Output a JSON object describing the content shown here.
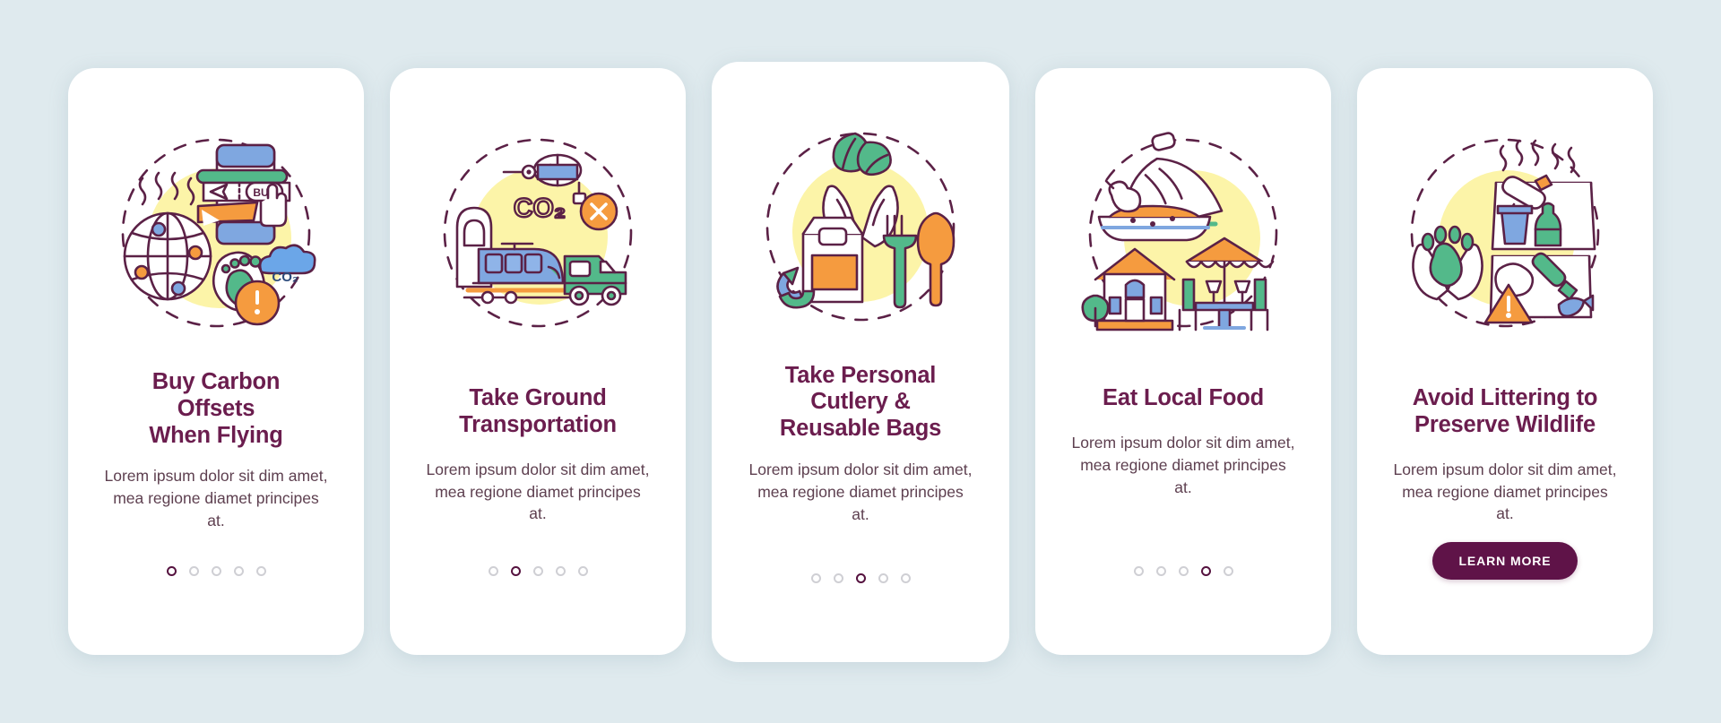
{
  "page": {
    "background_color": "#dfeaee",
    "title_color": "#6b1d4e",
    "body_color": "#5e4050",
    "accent_color": "#5f1348",
    "dot_inactive_color": "#cfcfd4",
    "card_background": "#ffffff"
  },
  "cards": [
    {
      "id": "buy-carbon-offsets-when-flying",
      "illustration_name": "globe-flight-ticket-carbon-footprint-illustration",
      "title": "Buy Carbon\nOffsets\nWhen Flying",
      "body": "Lorem ipsum dolor sit dim amet, mea regione diamet principes at.",
      "pagination": {
        "total": 5,
        "active_index": 0
      },
      "cta": null
    },
    {
      "id": "take-ground-transportation",
      "illustration_name": "plane-crossed-train-van-co2-illustration",
      "title": "Take Ground\nTransportation",
      "body": "Lorem ipsum dolor sit dim amet, mea regione diamet principes at.",
      "pagination": {
        "total": 5,
        "active_index": 1
      },
      "cta": null
    },
    {
      "id": "take-personal-cutlery-reusable-bags",
      "illustration_name": "hands-leaves-paper-bag-cutlery-illustration",
      "title": "Take Personal\nCutlery &\nReusable Bags",
      "body": "Lorem ipsum dolor sit dim amet, mea regione diamet principes at.",
      "pagination": {
        "total": 5,
        "active_index": 2
      },
      "cta": null
    },
    {
      "id": "eat-local-food",
      "illustration_name": "tagine-dish-house-cafe-table-illustration",
      "title": "Eat Local Food",
      "body": "Lorem ipsum dolor sit dim amet, mea regione diamet principes at.",
      "pagination": {
        "total": 5,
        "active_index": 3
      },
      "cta": null
    },
    {
      "id": "avoid-littering-to-preserve-wildlife",
      "illustration_name": "paw-hands-trash-bin-warning-illustration",
      "title": "Avoid Littering to\nPreserve Wildlife",
      "body": "Lorem ipsum dolor sit dim amet, mea regione diamet principes at.",
      "pagination": null,
      "cta": {
        "label": "LEARN MORE"
      }
    }
  ]
}
